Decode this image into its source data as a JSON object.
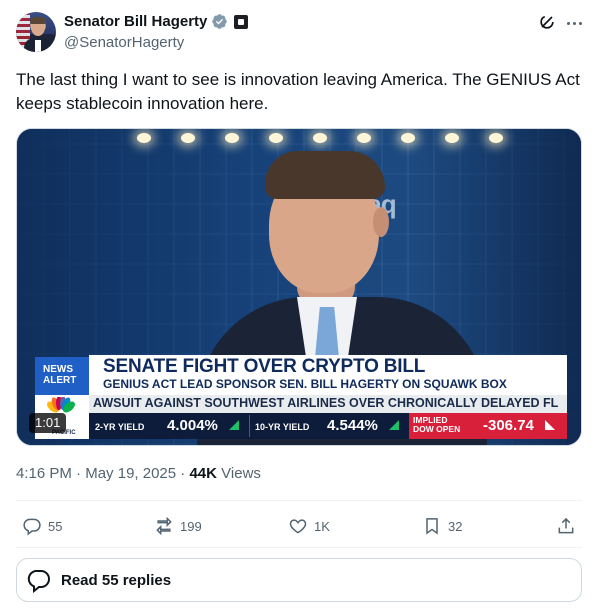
{
  "author": {
    "name": "Senator Bill Hagerty",
    "handle": "@SenatorHagerty"
  },
  "tweet": {
    "text": "The last thing I want to see is innovation leaving America. The GENIUS Act keeps stablecoin innovation here."
  },
  "video": {
    "duration": "1:01",
    "backdrop_text": "sdaq",
    "badge_line1": "NEWS",
    "badge_line2": "ALERT",
    "network_label": "PACIFIC",
    "headline": "SENATE FIGHT OVER CRYPTO BILL",
    "subheadline": "GENIUS ACT LEAD SPONSOR SEN. BILL HAGERTY ON SQUAWK BOX",
    "ticker": "AWSUIT AGAINST SOUTHWEST AIRLINES OVER CHRONICALLY DELAYED FL",
    "market": {
      "two_yr_label": "2-YR YIELD",
      "two_yr_value": "4.004%",
      "ten_yr_label": "10-YR YIELD",
      "ten_yr_value": "4.544%",
      "dow_label_line1": "IMPLIED",
      "dow_label_line2": "DOW OPEN",
      "dow_value": "-306.74"
    }
  },
  "meta": {
    "time": "4:16 PM",
    "date": "May 19, 2025",
    "views_count": "44K",
    "views_label": "Views"
  },
  "actions": {
    "replies": "55",
    "reposts": "199",
    "likes": "1K",
    "bookmarks": "32"
  },
  "read_replies_label": "Read 55 replies",
  "colors": {
    "text_primary": "#0f1419",
    "text_secondary": "#536471",
    "verified_badge": "#829aab",
    "border": "#cfd9de",
    "cnbc_blue": "#1f5fc6",
    "dow_red": "#d8203a"
  },
  "icons": [
    "verified-badge-icon",
    "government-affiliation-icon",
    "grok-icon",
    "more-icon",
    "reply-icon",
    "repost-icon",
    "like-icon",
    "bookmark-icon",
    "share-icon",
    "chat-bubbles-icon"
  ]
}
